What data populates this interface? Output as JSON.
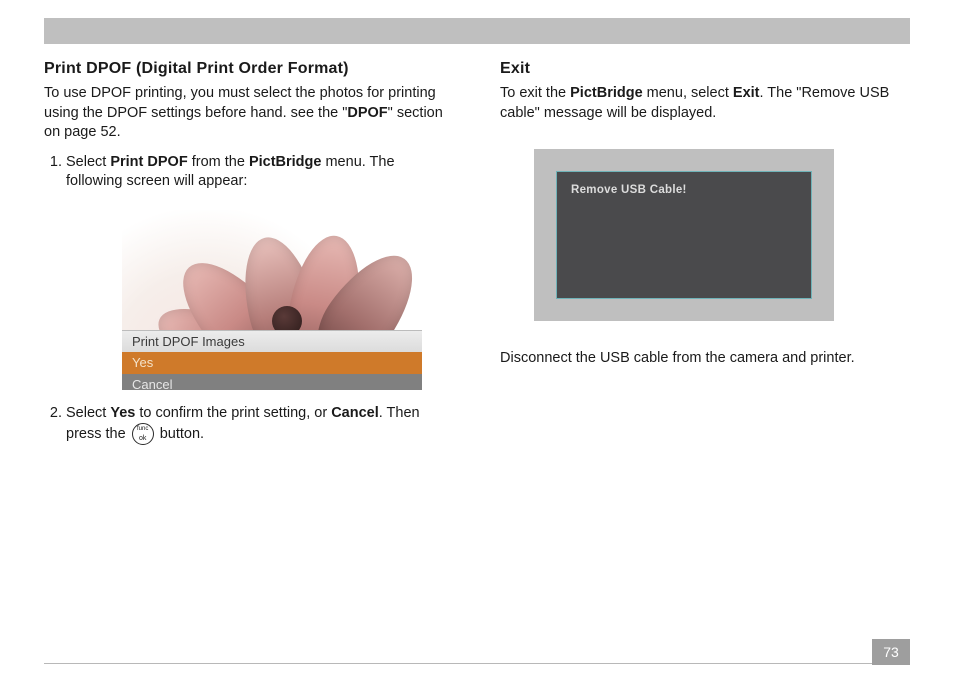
{
  "left": {
    "heading": "Print DPOF (Digital Print Order Format)",
    "intro_pre": "To use DPOF printing, you must select the photos for printing using the DPOF settings before hand. see the \"",
    "intro_bold": "DPOF",
    "intro_post": "\" section on page 52.",
    "step1_a": "Select ",
    "step1_b": "Print DPOF",
    "step1_c": " from the ",
    "step1_d": "PictBridge",
    "step1_e": " menu.  The following screen will appear:",
    "screenshot": {
      "menu_title": "Print DPOF Images",
      "menu_selected": "Yes",
      "menu_cancel": "Cancel"
    },
    "step2_a": "Select ",
    "step2_b": "Yes",
    "step2_c": " to confirm the print setting, or ",
    "step2_d": "Cancel",
    "step2_e": ". Then press the ",
    "step2_f": " button."
  },
  "right": {
    "heading": "Exit",
    "intro_a": "To exit the ",
    "intro_b": "PictBridge",
    "intro_c": " menu, select ",
    "intro_d": "Exit",
    "intro_e": ". The \"Remove USB cable\" message will be displayed.",
    "screenshot_msg": "Remove USB Cable!",
    "outro": "Disconnect the USB cable from the camera and printer."
  },
  "page_number": "73"
}
